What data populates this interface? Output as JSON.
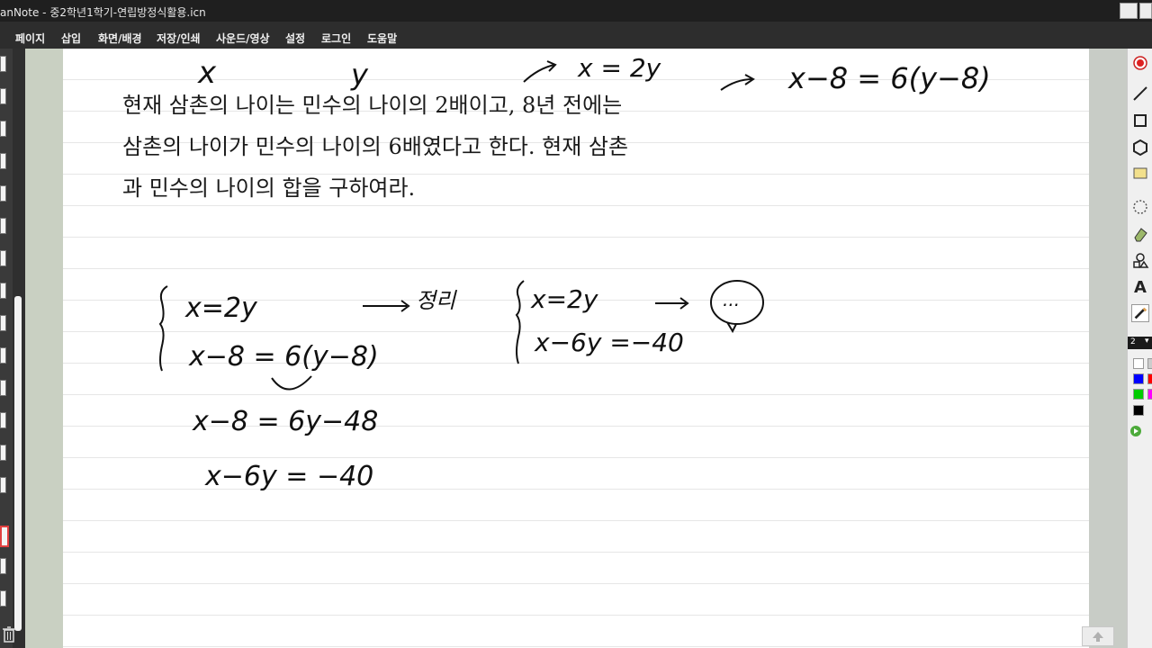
{
  "app": {
    "title": "anNote - 중2학년1학기-연립방정식활용.icn"
  },
  "menu": {
    "items": [
      "페이지",
      "삽입",
      "화면/배경",
      "저장/인쇄",
      "사운드/영상",
      "설정",
      "로그인",
      "도움말"
    ]
  },
  "problem": {
    "lines": [
      "현재 삼촌의 나이는 민수의 나이의  2배이고,  8년 전에는",
      "삼촌의 나이가 민수의 나이의  6배였다고 한다. 현재 삼촌",
      "과 민수의 나이의 합을 구하여라."
    ]
  },
  "handwriting": {
    "label_x": "x",
    "label_y": "y",
    "top_eq1": "x = 2y",
    "top_eq2": "x−8 = 6(y−8)",
    "system1_eq1": "x=2y",
    "system1_eq2": "x−8 = 6(y−8)",
    "step1": "x−8 = 6y−48",
    "step2": "x−6y = −40",
    "arrow_word": "정리",
    "system2_eq1": "x=2y",
    "system2_eq2": "x−6y =−40",
    "bubble": "..."
  },
  "toolbar": {
    "pen_size": "2"
  },
  "colors": {
    "swatches": [
      "#ffffff",
      "#0000ff",
      "#00cc00",
      "#000000",
      "#cccccc",
      "#ff0000",
      "#ff00ff"
    ]
  },
  "icons": [
    "record-icon",
    "line-icon",
    "rectangle-icon",
    "hexagon-icon",
    "sticky-note-icon",
    "lasso-icon",
    "eraser-icon",
    "shapes-icon",
    "text-icon",
    "pen-icon"
  ]
}
